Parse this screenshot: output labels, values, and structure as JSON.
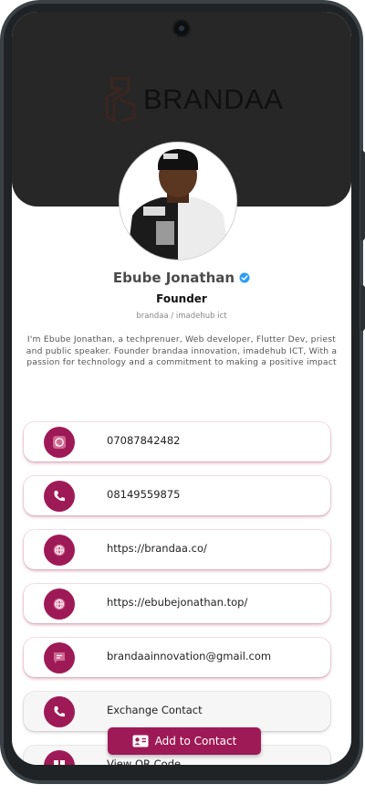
{
  "brand": {
    "logo_text": "BRANDAA"
  },
  "profile": {
    "name": "Ebube Jonathan",
    "title": "Founder",
    "company": "brandaa / imadehub ict",
    "bio": "I'm Ebube Jonathan, a techprenuer, Web developer, Flutter Dev, priest and public speaker. Founder brandaa innovation, imadehub ICT, With a passion for technology and a commitment to making a positive impact"
  },
  "contacts": [
    {
      "icon": "whatsapp-icon",
      "text": "07087842482"
    },
    {
      "icon": "phone-icon",
      "text": "08149559875"
    },
    {
      "icon": "globe-icon",
      "text": "https://brandaa.co/"
    },
    {
      "icon": "globe-icon",
      "text": "https://ebubejonathan.top/"
    },
    {
      "icon": "message-icon",
      "text": "brandaainnovation@gmail.com"
    },
    {
      "icon": "phone-icon",
      "text": "Exchange Contact"
    },
    {
      "icon": "qr-icon",
      "text": "View QR Code"
    }
  ],
  "actions": {
    "add_contact_label": "Add to Contact"
  },
  "colors": {
    "accent": "#9e1a56",
    "header": "#272727",
    "verified": "#2a9df4"
  }
}
